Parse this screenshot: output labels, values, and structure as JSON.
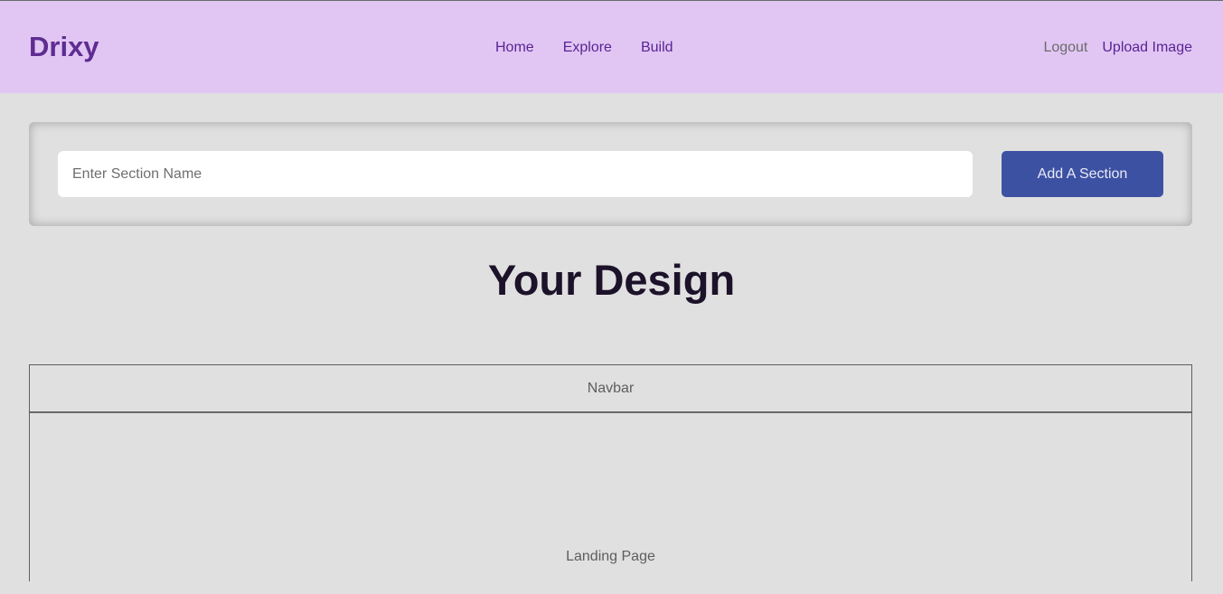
{
  "header": {
    "brand": "Drixy",
    "nav_center": [
      {
        "label": "Home"
      },
      {
        "label": "Explore"
      },
      {
        "label": "Build"
      }
    ],
    "nav_right": [
      {
        "label": "Logout"
      },
      {
        "label": "Upload Image"
      }
    ]
  },
  "section_form": {
    "input_placeholder": "Enter Section Name",
    "input_value": "",
    "add_button_label": "Add A Section"
  },
  "design": {
    "title": "Your Design",
    "sections": [
      {
        "label": "Navbar"
      },
      {
        "label": "Landing Page"
      }
    ]
  },
  "colors": {
    "header_bg": "#e1c6f4",
    "brand": "#5f2c91",
    "nav_link": "#5a2494",
    "page_bg": "#e0e0e0",
    "button_bg": "#3d51a3"
  }
}
